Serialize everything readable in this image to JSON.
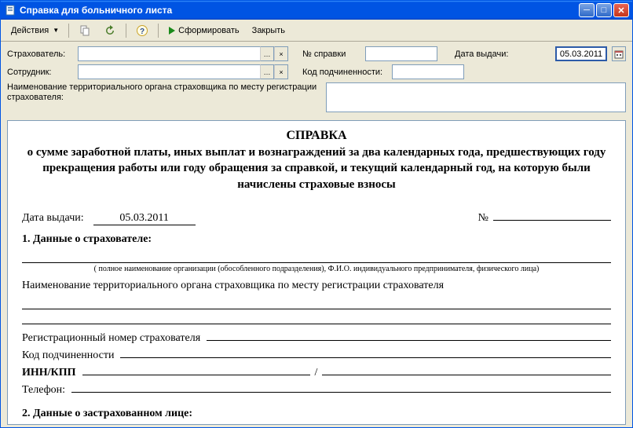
{
  "window": {
    "title": "Справка для больничного листа"
  },
  "toolbar": {
    "actions": "Действия",
    "form": "Сформировать",
    "close": "Закрыть"
  },
  "form": {
    "insurer_label": "Страхователь:",
    "insurer_value": "",
    "employee_label": "Сотрудник:",
    "employee_value": "",
    "cert_no_label": "№ справки",
    "cert_no_value": "",
    "issue_date_label": "Дата выдачи:",
    "issue_date_value": "05.03.2011",
    "sub_code_label": "Код подчиненности:",
    "sub_code_value": "",
    "territory_label": "Наименование территориального органа страховщика по месту регистрации страхователя:"
  },
  "doc": {
    "title": "СПРАВКА",
    "subtitle": "о сумме заработной платы, иных выплат и вознаграждений за два календарных года, предшествующих году прекращения работы или году обращения за справкой, и текущий календарный год, на которую были начислены страховые взносы",
    "date_label": "Дата выдачи:",
    "date_value": "05.03.2011",
    "num_label": "№",
    "section1": "1. Данные о страхователе:",
    "hint1": "( полное наименование организации (обособленного подразделения), Ф.И.О.  индивидуального предпринимателя, физического лица)",
    "territory": "Наименование территориального органа страховщика по месту регистрации страхователя",
    "reg_no": "Регистрационный номер страхователя",
    "sub_code": "Код подчиненности",
    "inn_kpp": "ИНН/КПП",
    "phone": "Телефон:",
    "section2": "2. Данные о застрахованном лице:"
  }
}
